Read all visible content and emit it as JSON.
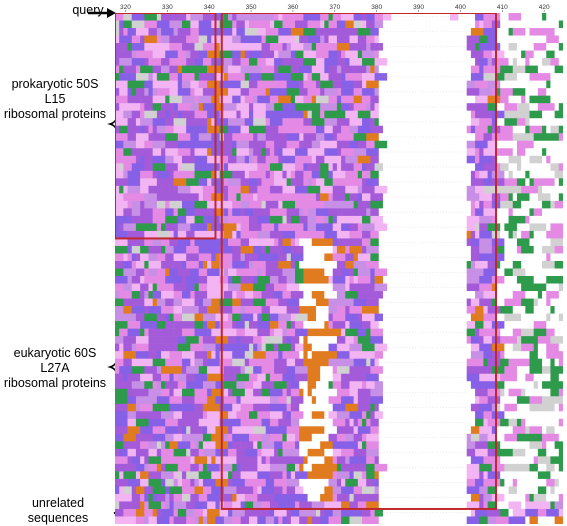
{
  "labels": {
    "query": "query",
    "prokaryotic": [
      "prokaryotic 50S L15",
      "ribosomal proteins"
    ],
    "eukaryotic": [
      "eukaryotic 60S L27A",
      "ribosomal proteins"
    ],
    "unrelated": [
      "unrelated",
      "sequences"
    ]
  },
  "ruler": {
    "ticks": [
      "320",
      "330",
      "340",
      "350",
      "360",
      "370",
      "380",
      "390",
      "400",
      "410",
      "420"
    ]
  },
  "alignment": {
    "first_column": 318,
    "last_column": 424,
    "sequences": {
      "query": 1,
      "prokaryotic": 29,
      "eukaryotic": 35,
      "unrelated": 3
    }
  },
  "colors": {
    "highlight_box": "#c0282d",
    "residue_palette": [
      "#a45bd9",
      "#e48ae4",
      "#8660e6",
      "#f2b4f2",
      "#c78fe6",
      "#2e9a4b",
      "#e07b1f",
      "#d1d1d1"
    ]
  }
}
